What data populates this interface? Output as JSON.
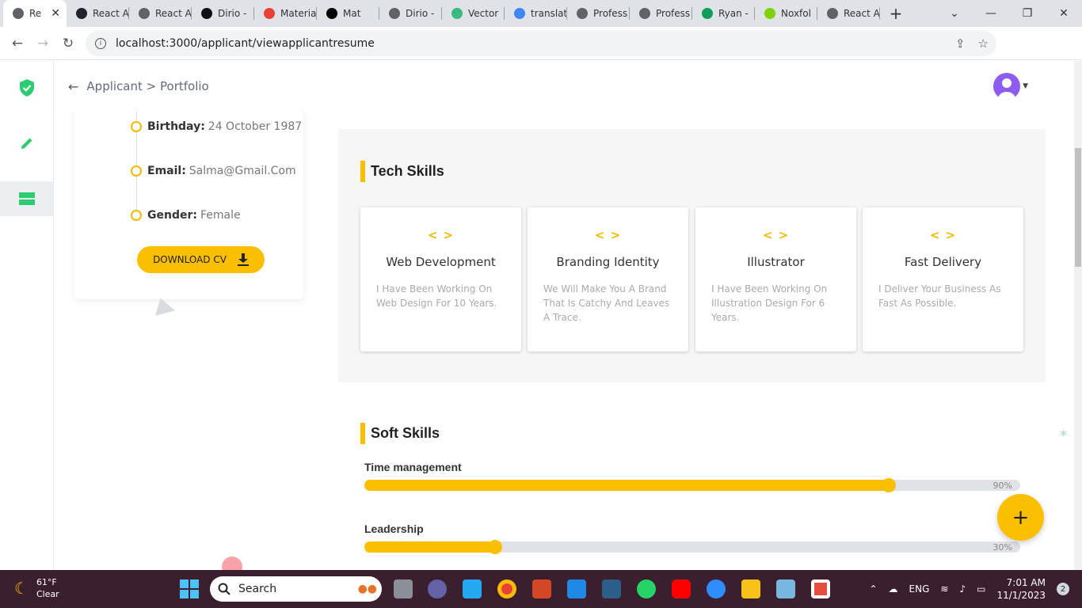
{
  "browser": {
    "tabs": [
      {
        "label": "Re",
        "icon": "chrome-page-icon",
        "color": "#5f6368",
        "active": true
      },
      {
        "label": "React A",
        "icon": "react-icon",
        "color": "#20232a"
      },
      {
        "label": "React A",
        "icon": "chrome-page-icon",
        "color": "#5f6368"
      },
      {
        "label": "Dirio -",
        "icon": "dirio-icon",
        "color": "#111111"
      },
      {
        "label": "Materia",
        "icon": "material-icon",
        "color": "#e94235"
      },
      {
        "label": "Mat",
        "icon": "mat-icon",
        "color": "#000000"
      },
      {
        "label": "Dirio -",
        "icon": "chrome-page-icon",
        "color": "#5f6368"
      },
      {
        "label": "Vector",
        "icon": "vector-icon",
        "color": "#3ab981"
      },
      {
        "label": "translat",
        "icon": "google-icon",
        "color": "#4285f4"
      },
      {
        "label": "Profess",
        "icon": "chrome-page-icon",
        "color": "#5f6368"
      },
      {
        "label": "Profess",
        "icon": "chrome-page-icon",
        "color": "#5f6368"
      },
      {
        "label": "Ryan -",
        "icon": "ryan-icon",
        "color": "#0f9d58"
      },
      {
        "label": "Noxfol",
        "icon": "noxfolio-icon",
        "color": "#7cd300"
      },
      {
        "label": "React A",
        "icon": "chrome-page-icon",
        "color": "#5f6368"
      }
    ],
    "url": "localhost:3000/applicant/viewapplicantresume"
  },
  "header": {
    "breadcrumb_parent": "Applicant",
    "breadcrumb_sep": ">",
    "breadcrumb_current": "Portfolio"
  },
  "profile": {
    "rows": [
      {
        "key": "Birthday:",
        "value": "24 October 1987"
      },
      {
        "key": "Email:",
        "value": "Salma@Gmail.Com"
      },
      {
        "key": "Gender:",
        "value": "Female"
      }
    ],
    "download_label": "DOWNLOAD CV"
  },
  "tech_skills": {
    "title": "Tech Skills",
    "icon_glyph": "< >",
    "items": [
      {
        "name": "Web Development",
        "desc": "I Have Been Working On Web Design For 10 Years."
      },
      {
        "name": "Branding Identity",
        "desc": "We Will Make You A Brand That Is Catchy And Leaves A Trace."
      },
      {
        "name": "Illustrator",
        "desc": "I Have Been Working On Illustration Design For 6 Years."
      },
      {
        "name": "Fast Delivery",
        "desc": "I Deliver Your Business As Fast As Possible."
      }
    ]
  },
  "soft_skills": {
    "title": "Soft Skills",
    "items": [
      {
        "name": "Time management",
        "percent": 90,
        "percent_label": "90%"
      },
      {
        "name": "Leadership",
        "percent": 30,
        "percent_label": "30%"
      }
    ]
  },
  "fab_label": "+",
  "taskbar": {
    "temp": "61°F",
    "condition": "Clear",
    "search_placeholder": "Search",
    "lang": "ENG",
    "time": "7:01 AM",
    "date": "11/1/2023",
    "notifications": "2"
  },
  "colors": {
    "accent": "#fbbf00",
    "sidebar_green": "#2ecc71"
  }
}
